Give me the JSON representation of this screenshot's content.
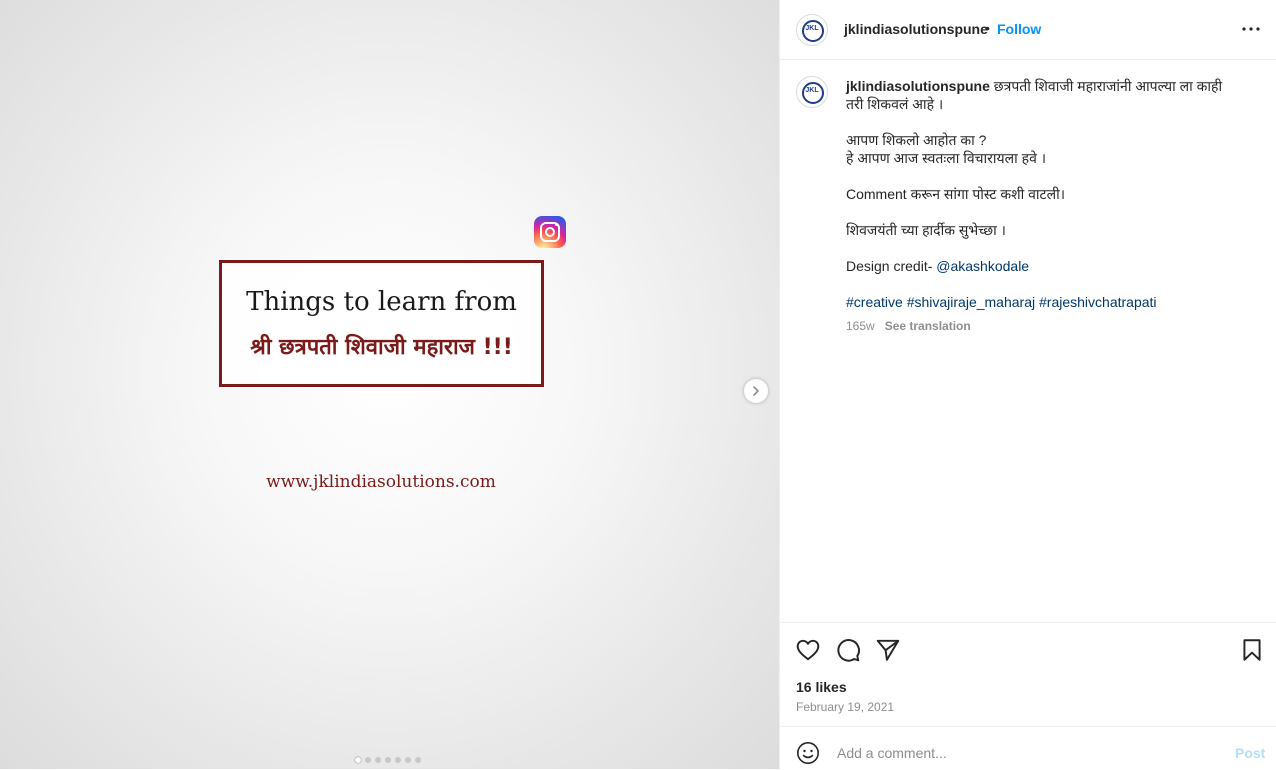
{
  "media": {
    "line1": "Things to learn from",
    "line2": "श्री छत्रपती शिवाजी महाराज !!!",
    "website": "www.jklindiasolutions.com",
    "slide_count": 7,
    "active_slide": 1
  },
  "header": {
    "avatar_text": "JKL",
    "username": "jklindiasolutionspune",
    "separator": "•",
    "follow_label": "Follow",
    "more_icon": "more-horizontal-icon"
  },
  "caption": {
    "avatar_text": "JKL",
    "username": "jklindiasolutionspune",
    "text1": "छत्रपती शिवाजी महाराजांनी आपल्या ला काही तरी शिकवलं आहे ।",
    "text2": "आपण शिकलो आहोत का ?",
    "text3": "हे आपण आज स्वतःला विचारायला हवे ।",
    "text4": "Comment करून सांगा पोस्ट कशी वाटली।",
    "text5": "शिवजयंती च्या हार्दीक सुभेच्छा ।",
    "credit_prefix": "Design credit- ",
    "credit_mention": "@akashkodale",
    "hashtags": [
      "#creative",
      "#shivajiraje_maharaj",
      "#rajeshivchatrapati"
    ],
    "age": "165w",
    "see_translation": "See translation"
  },
  "actions": {
    "likes": "16 likes",
    "date": "February 19, 2021"
  },
  "comment": {
    "placeholder": "Add a comment...",
    "post_label": "Post"
  },
  "colors": {
    "accent": "#0095f6",
    "brand_maroon": "#7a1a1a",
    "link": "#00376b",
    "muted": "#8e8e8e"
  }
}
